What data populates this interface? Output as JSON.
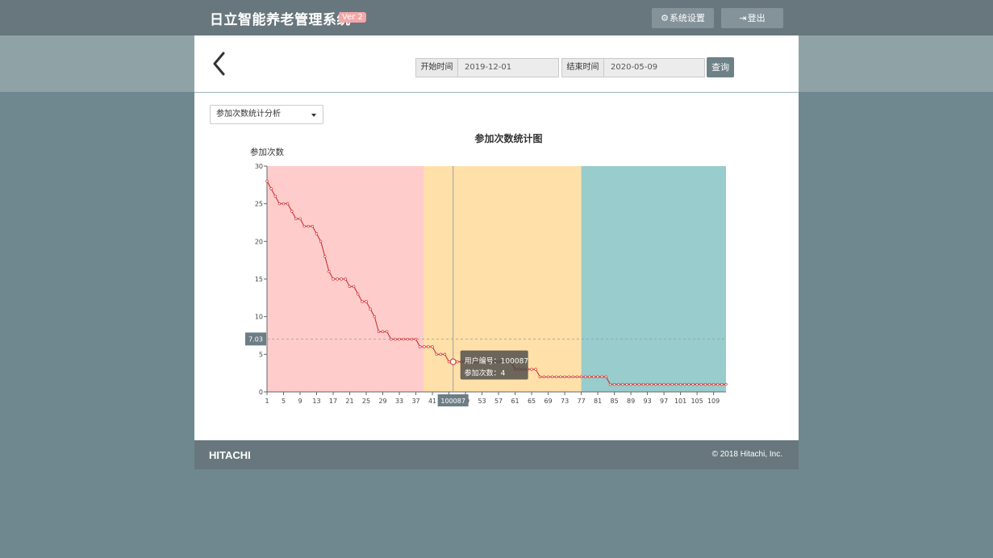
{
  "header": {
    "app_title": "日立智能养老管理系统",
    "version_badge": "Ver 2",
    "settings_label": "系统设置",
    "logout_label": "登出",
    "settings_icon": "gear-icon",
    "logout_icon": "sign-out-icon"
  },
  "filter": {
    "start_label": "开始时间",
    "start_value": "2019-12-01",
    "end_label": "结束时间",
    "end_value": "2020-05-09",
    "query_label": "查询"
  },
  "analysis_select": {
    "selected": "参加次数统计分析"
  },
  "chart_data": {
    "type": "line",
    "title": "参加次数统计图",
    "ylabel": "参加次数",
    "xlabel": "",
    "ylim": [
      0,
      30
    ],
    "yticks": [
      0,
      5,
      10,
      15,
      20,
      25,
      30
    ],
    "xlim": [
      1,
      112
    ],
    "xticks": [
      1,
      5,
      9,
      13,
      17,
      21,
      25,
      29,
      33,
      37,
      41,
      45,
      49,
      53,
      57,
      61,
      65,
      69,
      73,
      77,
      81,
      85,
      89,
      93,
      97,
      101,
      105,
      109
    ],
    "average_line": 7.03,
    "average_label": "7.03",
    "bands": [
      {
        "from": 1,
        "to": 39,
        "color": "#ffcccc"
      },
      {
        "from": 39,
        "to": 77,
        "color": "#ffe0a8"
      },
      {
        "from": 77,
        "to": 112,
        "color": "#99cccc"
      }
    ],
    "series": [
      {
        "color": "#cc2222",
        "values": [
          28,
          27,
          26,
          25,
          25,
          25,
          24,
          23,
          23,
          22,
          22,
          22,
          21,
          20,
          18,
          16,
          15,
          15,
          15,
          15,
          14,
          14,
          13,
          12,
          12,
          11,
          10,
          8,
          8,
          8,
          7,
          7,
          7,
          7,
          7,
          7,
          7,
          6,
          6,
          6,
          6,
          5,
          5,
          5,
          4,
          4,
          4,
          4,
          4,
          4,
          4,
          4,
          4,
          4,
          4,
          4,
          4,
          4,
          4,
          4,
          3,
          3,
          3,
          3,
          3,
          3,
          2,
          2,
          2,
          2,
          2,
          2,
          2,
          2,
          2,
          2,
          2,
          2,
          2,
          2,
          2,
          2,
          2,
          1,
          1,
          1,
          1,
          1,
          1,
          1,
          1,
          1,
          1,
          1,
          1,
          1,
          1,
          1,
          1,
          1,
          1,
          1,
          1,
          1,
          1,
          1,
          1,
          1,
          1,
          1,
          1,
          1
        ]
      }
    ],
    "crosshair": {
      "x": 46,
      "x_label": "100087"
    },
    "tooltip": {
      "user_id_label": "用户编号",
      "user_id": "100087",
      "count_label": "参加次数",
      "count": "4"
    }
  },
  "footer": {
    "logo": "HITACHI",
    "copyright": "© 2018 Hitachi, Inc."
  }
}
